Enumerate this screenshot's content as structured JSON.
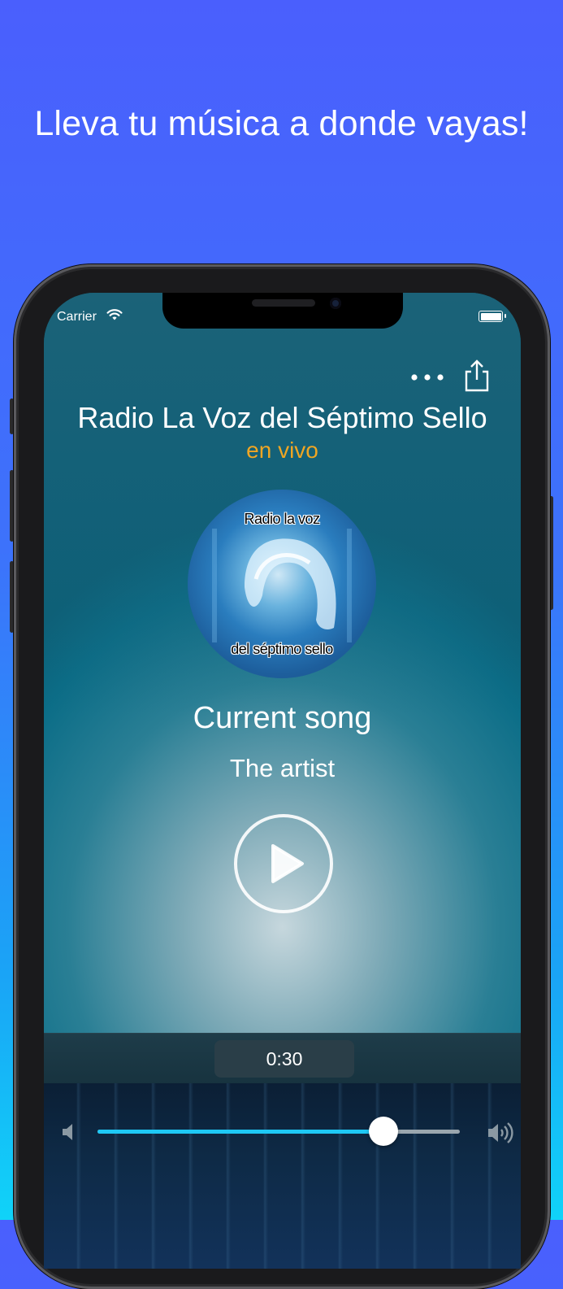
{
  "promo": {
    "headline": "Lleva tu música a donde vayas!"
  },
  "status_bar": {
    "carrier": "Carrier",
    "icons": [
      "wifi-icon",
      "battery-icon"
    ]
  },
  "toolbar": {
    "more_icon": "more-horizontal-icon",
    "share_icon": "share-icon"
  },
  "station": {
    "name": "Radio La Voz del Séptimo Sello",
    "status": "en vivo",
    "status_color": "#f0a623"
  },
  "artwork": {
    "top_text": "Radio la voz",
    "bottom_text": "del séptimo sello"
  },
  "now_playing": {
    "song": "Current song",
    "artist": "The artist"
  },
  "controls": {
    "play_icon": "play-icon",
    "timer": "0:30"
  },
  "volume": {
    "level": 0.79,
    "accent_color": "#1ec8f5",
    "min_icon": "speaker-low-icon",
    "max_icon": "speaker-high-icon"
  }
}
